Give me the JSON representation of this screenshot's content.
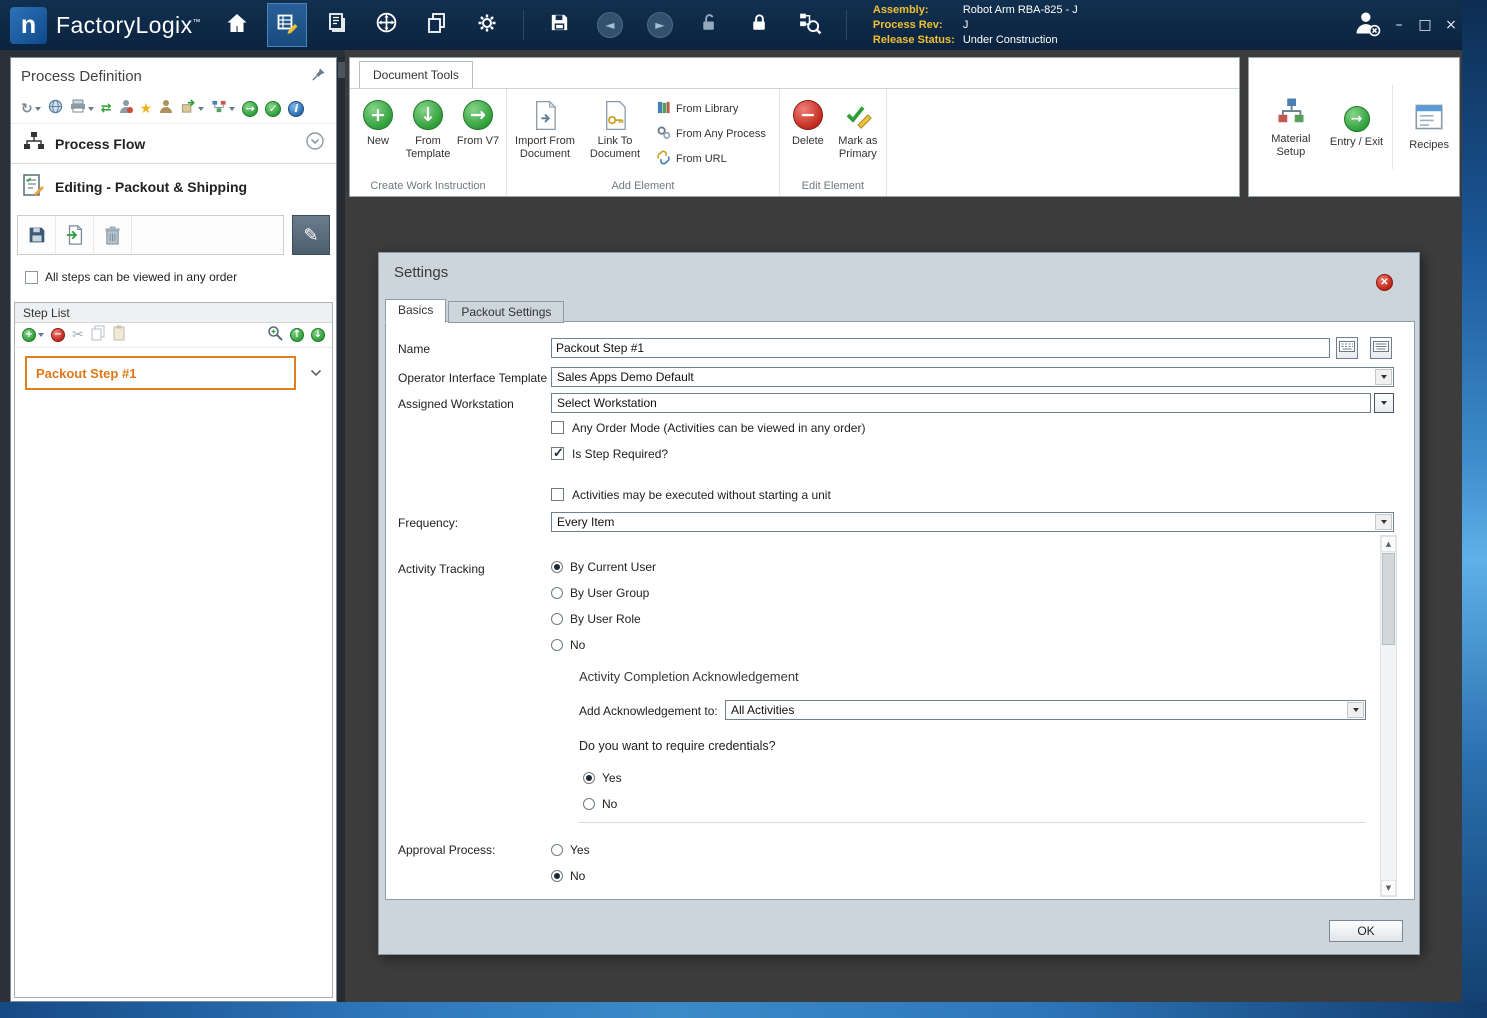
{
  "titlebar": {
    "logo_letter": "n",
    "app_name": "FactoryLogix",
    "trademark": "™",
    "assembly": {
      "label": "Assembly:",
      "value": "Robot Arm RBA-825 - J"
    },
    "process_rev": {
      "label": "Process Rev:",
      "value": "J"
    },
    "release_status": {
      "label": "Release Status:",
      "value": "Under Construction"
    }
  },
  "sidebar": {
    "title": "Process Definition",
    "process_flow_label": "Process Flow",
    "editing_label": "Editing - Packout & Shipping",
    "any_order_label": "All steps can be viewed in any order",
    "step_list": {
      "title": "Step List",
      "steps": [
        {
          "label": "Packout Step #1",
          "selected": true
        }
      ]
    }
  },
  "ribbon": {
    "tab_label": "Document Tools",
    "create_group": {
      "caption": "Create Work Instruction",
      "new_label": "New",
      "from_template_label": "From Template",
      "from_v7_label": "From V7"
    },
    "add_group": {
      "caption": "Add Element",
      "import_label": "Import From Document",
      "link_label": "Link To Document",
      "from_library_label": "From Library",
      "from_any_process_label": "From Any Process",
      "from_url_label": "From URL"
    },
    "edit_group": {
      "caption": "Edit Element",
      "delete_label": "Delete",
      "mark_primary_label": "Mark as Primary"
    },
    "tools_group": {
      "material_setup_label": "Material Setup",
      "entry_exit_label": "Entry / Exit",
      "recipes_label": "Recipes"
    }
  },
  "dialog": {
    "title": "Settings",
    "tabs": [
      {
        "label": "Basics",
        "active": true
      },
      {
        "label": "Packout Settings",
        "active": false
      }
    ],
    "name_field": {
      "label": "Name",
      "value": "Packout Step #1"
    },
    "template_field": {
      "label": "Operator Interface Template",
      "value": "Sales Apps Demo Default"
    },
    "workstation_field": {
      "label": "Assigned Workstation",
      "value": "Select Workstation"
    },
    "any_order_checkbox": {
      "label": "Any Order Mode (Activities can be viewed in any order)",
      "checked": false
    },
    "step_required_checkbox": {
      "label": "Is Step Required?",
      "checked": true
    },
    "without_unit_checkbox": {
      "label": "Activities may be executed without starting a unit",
      "checked": false
    },
    "frequency_field": {
      "label": "Frequency:",
      "value": "Every Item"
    },
    "activity_tracking": {
      "label": "Activity Tracking",
      "options": [
        "By Current User",
        "By User Group",
        "By User Role",
        "No"
      ],
      "selected": "By Current User"
    },
    "acknowledgement": {
      "heading": "Activity Completion Acknowledgement",
      "add_label": "Add Acknowledgement to:",
      "value": "All Activities"
    },
    "credentials": {
      "question": "Do you want to require credentials?",
      "options": [
        "Yes",
        "No"
      ],
      "selected": "Yes"
    },
    "approval": {
      "label": "Approval Process:",
      "options": [
        "Yes",
        "No"
      ],
      "selected": "No"
    },
    "ok_label": "OK"
  },
  "colors": {
    "titlebar": "#0b2340",
    "accent_orange": "#e07818",
    "dialog_bg": "#ccd5db",
    "canvas_bg": "#3c3c3c",
    "label_gold": "#f0c030",
    "green_icon": "#2f9e3a",
    "red_icon": "#c1281e"
  },
  "icons": {
    "titlebar": [
      "home-icon",
      "process-definition-icon",
      "documents-stack-icon",
      "navigator-icon",
      "copy-documents-icon",
      "settings-gear-icon",
      "save-icon",
      "back-icon",
      "forward-icon",
      "unlock-icon",
      "lock-icon",
      "find-process-icon",
      "user-logout-icon"
    ],
    "window_controls": [
      "minimize-icon",
      "maximize-icon",
      "close-icon"
    ]
  }
}
